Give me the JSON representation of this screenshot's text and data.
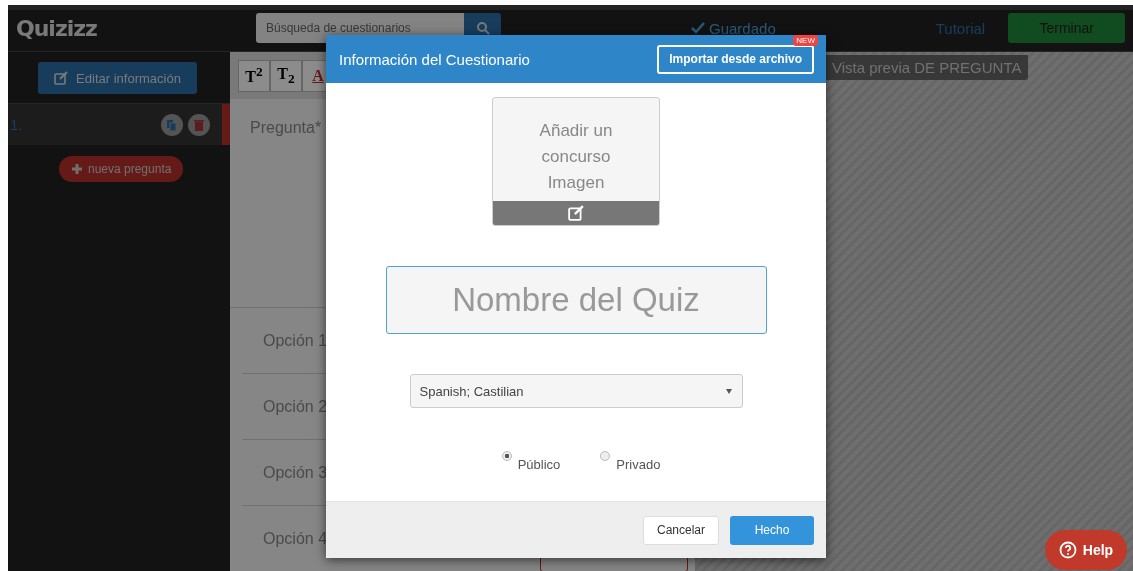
{
  "topbar": {
    "logo": "Quizizz",
    "search": {
      "placeholder": "Búsqueda de cuestionarios"
    },
    "status": "Guardado",
    "tutorial": "Tutorial",
    "finish": "Terminar"
  },
  "sidebar": {
    "edit_button": "Editar información",
    "questions": [
      {
        "number": "1.",
        "selected": true
      }
    ],
    "new_question": "nueva pregunta"
  },
  "editor": {
    "toolbar": [
      {
        "kind": "format",
        "label": "T$^{2}$"
      },
      {
        "kind": "format",
        "label": "T$_{2}$"
      },
      {
        "kind": "color",
        "label": "A"
      }
    ],
    "question_label": "Pregunta*",
    "options": [
      "Opción 1",
      "Opción 2",
      "Opción 3",
      "Opción 4"
    ]
  },
  "preview": {
    "label": "Vista previa DE PREGUNTA"
  },
  "modal": {
    "title": "Información del Cuestionario",
    "import_button": "Importar desde archivo",
    "import_badge": "NEW",
    "image_placeholder": "Añadir un concurso Imagen",
    "name_field": {
      "placeholder": "Nombre del Quiz"
    },
    "language": "Spanish; Castilian",
    "visibility": [
      {
        "label": "Público",
        "selected": true
      },
      {
        "label": "Privado",
        "selected": false
      }
    ],
    "buttons": [
      {
        "label": "Cancelar",
        "kind": "secondary"
      },
      {
        "label": "Hecho",
        "kind": "primary"
      }
    ]
  },
  "help": "Help"
}
